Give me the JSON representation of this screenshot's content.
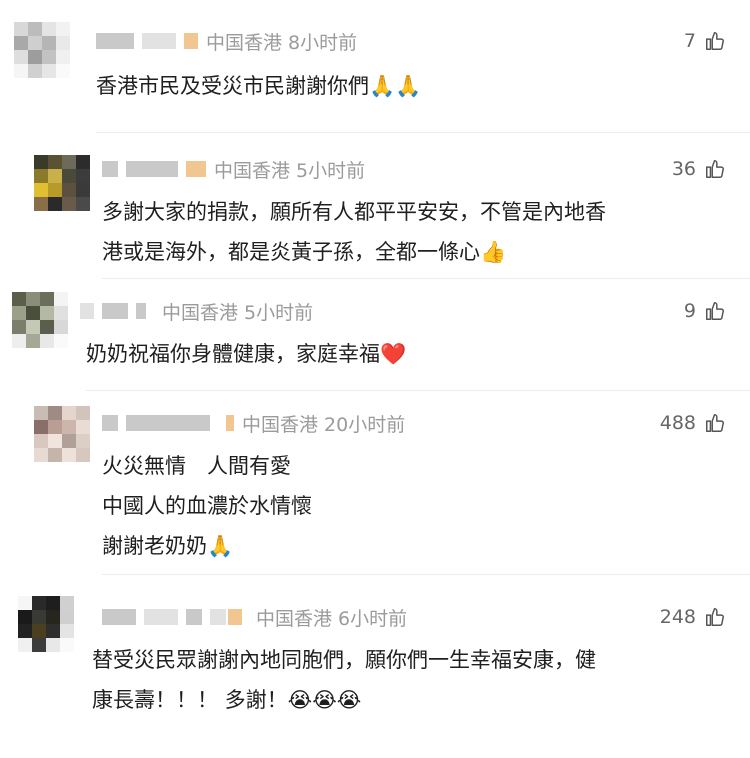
{
  "comments": [
    {
      "location_time": "中国香港 8小时前",
      "likes": "7",
      "lines": [
        "香港市民及受災市民謝謝你們🙏🙏"
      ]
    },
    {
      "location_time": "中国香港 5小时前",
      "likes": "36",
      "lines": [
        "多謝大家的捐款，願所有人都平平安安，不管是內地香",
        "港或是海外，都是炎黃子孫，全都一條心👍"
      ]
    },
    {
      "location_time": "中国香港 5小时前",
      "likes": "9",
      "lines": [
        "奶奶祝福你身體健康，家庭幸福❤️"
      ]
    },
    {
      "location_time": "中国香港 20小时前",
      "likes": "488",
      "lines": [
        "火災無情　人間有愛",
        "中國人的血濃於水情懷",
        "謝謝老奶奶🙏"
      ]
    },
    {
      "location_time": "中国香港 6小时前",
      "likes": "248",
      "lines": [
        "替受災民眾謝謝內地同胞們，願你們一生幸福安康，健",
        "康長壽！！！ 多謝！😭😭😭"
      ]
    }
  ],
  "icons": {
    "like": "thumbs-up-icon"
  },
  "colors": {
    "meta": "#9b9b9b",
    "text": "#1f1f1f",
    "divider": "#ececec"
  }
}
